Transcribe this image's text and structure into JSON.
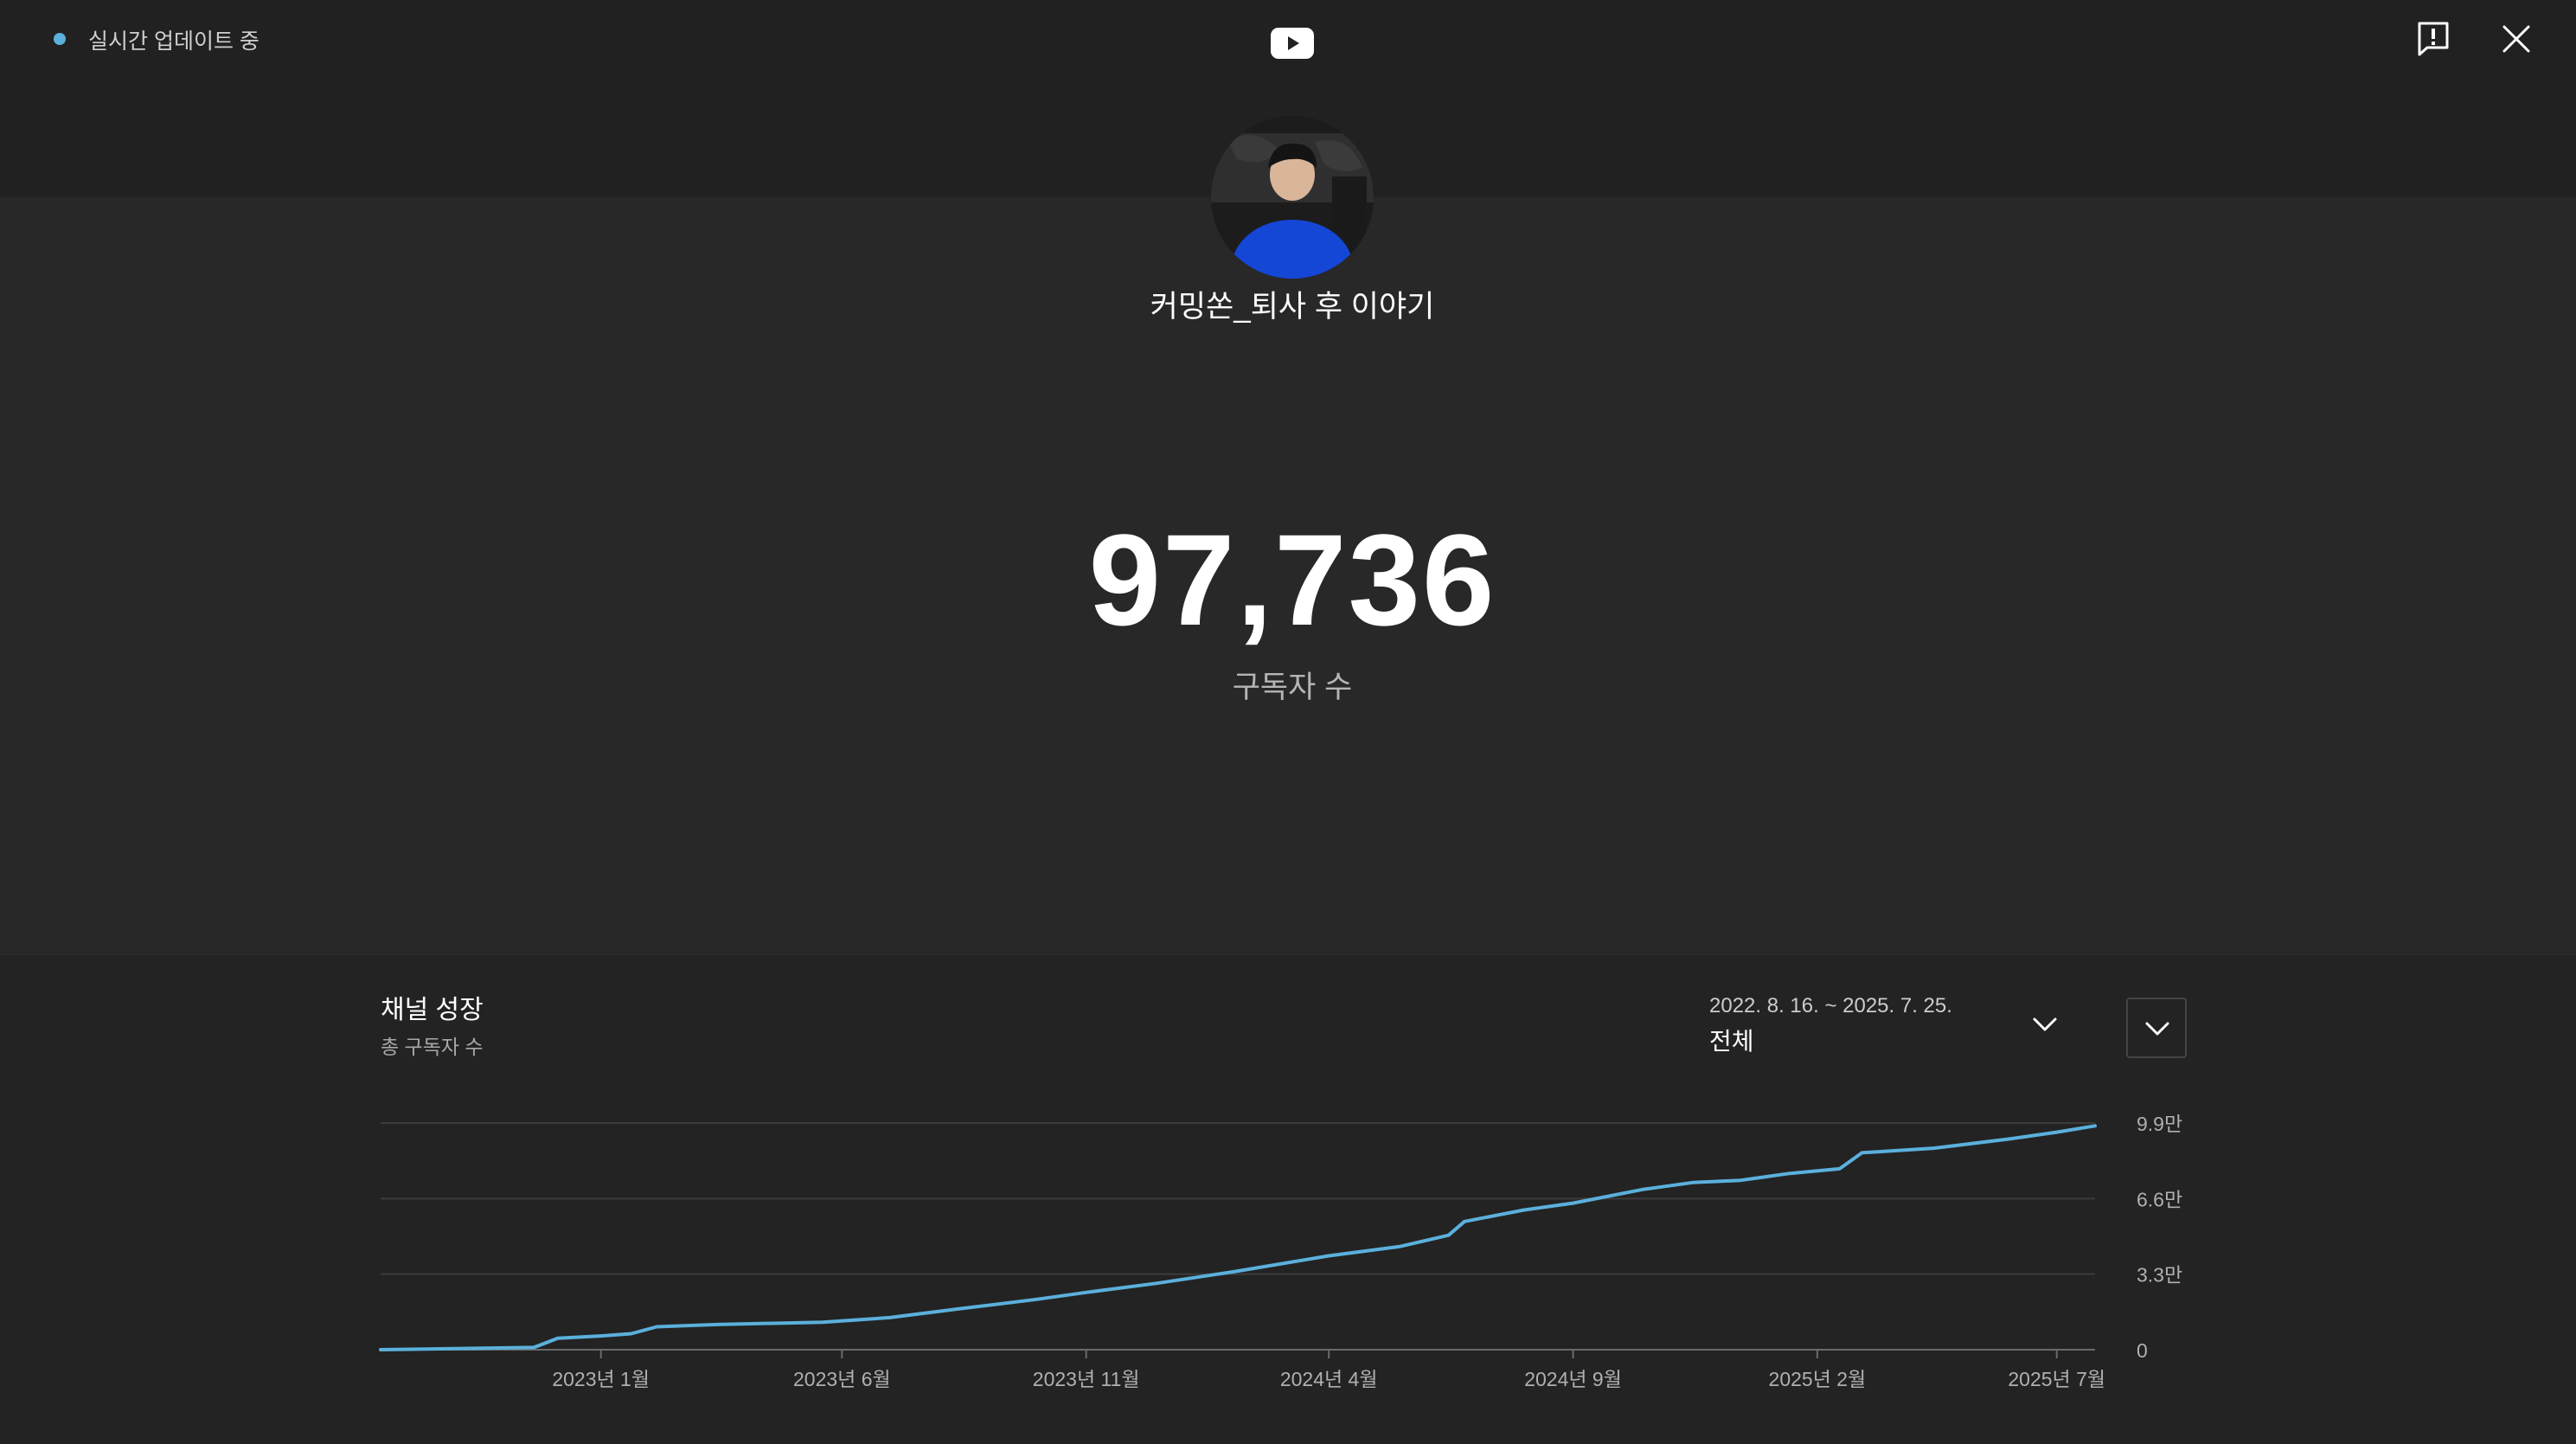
{
  "header": {
    "live_status": "실시간 업데이트 중",
    "brand_icon": "youtube-play-icon",
    "feedback_icon": "feedback-icon",
    "close_icon": "close-icon"
  },
  "channel": {
    "name": "커밍쏜_퇴사 후 이야기",
    "subscriber_count": "97,736",
    "subscriber_label": "구독자 수"
  },
  "growth": {
    "title": "채널 성장",
    "subtitle": "총 구독자 수",
    "date_range": "2022. 8. 16. ~ 2025. 7. 25.",
    "period": "전체"
  },
  "colors": {
    "background": "#282828",
    "header_background": "#212121",
    "panel_background": "#232323",
    "accent": "#5bb0dc"
  },
  "chart_data": {
    "type": "line",
    "x_unit": "date",
    "xlim": [
      "2022-08-16",
      "2025-07-25"
    ],
    "ylim": [
      0,
      99000
    ],
    "y_ticks": [
      {
        "value": 0,
        "label": "0"
      },
      {
        "value": 33000,
        "label": "3.3만"
      },
      {
        "value": 66000,
        "label": "6.6만"
      },
      {
        "value": 99000,
        "label": "9.9만"
      }
    ],
    "x_ticks": [
      {
        "date": "2023-01-01",
        "label": "2023년 1월"
      },
      {
        "date": "2023-06-01",
        "label": "2023년 6월"
      },
      {
        "date": "2023-11-01",
        "label": "2023년 11월"
      },
      {
        "date": "2024-04-01",
        "label": "2024년 4월"
      },
      {
        "date": "2024-09-01",
        "label": "2024년 9월"
      },
      {
        "date": "2025-02-01",
        "label": "2025년 2월"
      },
      {
        "date": "2025-07-01",
        "label": "2025년 7월"
      }
    ],
    "grid": true,
    "series": [
      {
        "color": "#5bb0dc",
        "points": [
          [
            "2022-08-16",
            0
          ],
          [
            "2022-10-01",
            500
          ],
          [
            "2022-11-20",
            1000
          ],
          [
            "2022-12-05",
            5000
          ],
          [
            "2023-01-01",
            6000
          ],
          [
            "2023-01-20",
            7000
          ],
          [
            "2023-02-05",
            10000
          ],
          [
            "2023-03-15",
            11000
          ],
          [
            "2023-05-20",
            12000
          ],
          [
            "2023-07-01",
            14000
          ],
          [
            "2023-08-15",
            18000
          ],
          [
            "2023-10-01",
            22000
          ],
          [
            "2023-11-01",
            25000
          ],
          [
            "2023-12-15",
            29000
          ],
          [
            "2024-02-01",
            34000
          ],
          [
            "2024-04-01",
            41000
          ],
          [
            "2024-05-15",
            45000
          ],
          [
            "2024-06-15",
            50000
          ],
          [
            "2024-06-25",
            56000
          ],
          [
            "2024-08-01",
            61000
          ],
          [
            "2024-09-01",
            64000
          ],
          [
            "2024-10-15",
            70000
          ],
          [
            "2024-11-15",
            73000
          ],
          [
            "2024-12-15",
            74000
          ],
          [
            "2025-01-15",
            77000
          ],
          [
            "2025-02-15",
            79000
          ],
          [
            "2025-03-01",
            86000
          ],
          [
            "2025-04-15",
            88000
          ],
          [
            "2025-06-01",
            92000
          ],
          [
            "2025-07-01",
            95000
          ],
          [
            "2025-07-25",
            97736
          ]
        ]
      }
    ]
  }
}
